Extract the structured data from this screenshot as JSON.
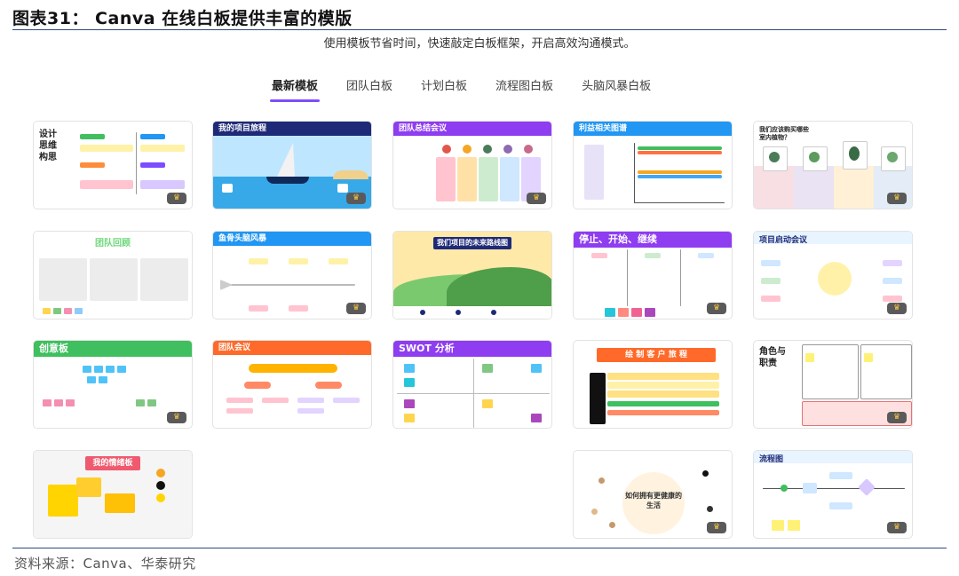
{
  "figure": {
    "title": "图表31： Canva 在线白板提供丰富的模版",
    "subtitle": "使用模板节省时间，快速敲定白板框架，开启高效沟通模式。",
    "source": "资料来源：Canva、华泰研究"
  },
  "tabs": [
    {
      "label": "最新模板",
      "active": true
    },
    {
      "label": "团队白板",
      "active": false
    },
    {
      "label": "计划白板",
      "active": false
    },
    {
      "label": "流程图白板",
      "active": false
    },
    {
      "label": "头脑风暴白板",
      "active": false
    }
  ],
  "templates": {
    "design_thinking": "设计\n思维\n构思",
    "my_project_journey": "我的项目旅程",
    "team_summary": "团队总结会议",
    "stakeholder_map": "利益相关图谱",
    "plants": "我们应该购买哪些室内植物？",
    "team_retro": "团队回顾",
    "fishbone": "鱼骨头脑风暴",
    "roadmap": "我们项目的未来路线图",
    "stop_start_continue": "停止、开始、继续",
    "kickoff": "项目启动会议",
    "idea_board": "创意板",
    "team_meeting": "团队会议",
    "swot": "SWOT 分析",
    "customer_journey": "绘 制 客 户 旅 程",
    "roles": "角色与\n职责",
    "mood_board": "我的情绪板",
    "healthy_life": "如何拥有更健康的\n生活",
    "flowchart": "流程图"
  },
  "colors": {
    "accent": "#7c4dff",
    "navy": "#1e2a78",
    "purple": "#8e3df0",
    "blue": "#2196f3",
    "green": "#3fbf5f",
    "orange": "#ff6a2a",
    "yellow": "#ffcf3a"
  },
  "icons": {
    "premium": "crown-icon"
  },
  "premium_badge": "♛"
}
